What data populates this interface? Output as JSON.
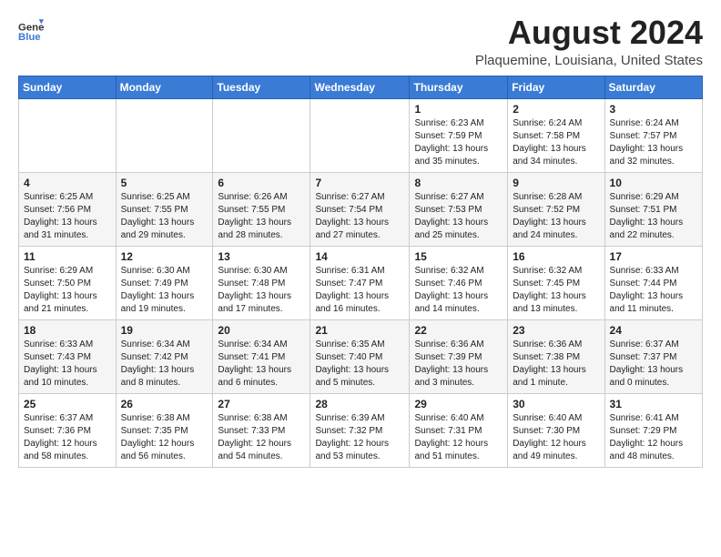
{
  "header": {
    "logo_general": "General",
    "logo_blue": "Blue",
    "month_year": "August 2024",
    "location": "Plaquemine, Louisiana, United States"
  },
  "weekdays": [
    "Sunday",
    "Monday",
    "Tuesday",
    "Wednesday",
    "Thursday",
    "Friday",
    "Saturday"
  ],
  "weeks": [
    [
      {
        "day": "",
        "info": ""
      },
      {
        "day": "",
        "info": ""
      },
      {
        "day": "",
        "info": ""
      },
      {
        "day": "",
        "info": ""
      },
      {
        "day": "1",
        "info": "Sunrise: 6:23 AM\nSunset: 7:59 PM\nDaylight: 13 hours\nand 35 minutes."
      },
      {
        "day": "2",
        "info": "Sunrise: 6:24 AM\nSunset: 7:58 PM\nDaylight: 13 hours\nand 34 minutes."
      },
      {
        "day": "3",
        "info": "Sunrise: 6:24 AM\nSunset: 7:57 PM\nDaylight: 13 hours\nand 32 minutes."
      }
    ],
    [
      {
        "day": "4",
        "info": "Sunrise: 6:25 AM\nSunset: 7:56 PM\nDaylight: 13 hours\nand 31 minutes."
      },
      {
        "day": "5",
        "info": "Sunrise: 6:25 AM\nSunset: 7:55 PM\nDaylight: 13 hours\nand 29 minutes."
      },
      {
        "day": "6",
        "info": "Sunrise: 6:26 AM\nSunset: 7:55 PM\nDaylight: 13 hours\nand 28 minutes."
      },
      {
        "day": "7",
        "info": "Sunrise: 6:27 AM\nSunset: 7:54 PM\nDaylight: 13 hours\nand 27 minutes."
      },
      {
        "day": "8",
        "info": "Sunrise: 6:27 AM\nSunset: 7:53 PM\nDaylight: 13 hours\nand 25 minutes."
      },
      {
        "day": "9",
        "info": "Sunrise: 6:28 AM\nSunset: 7:52 PM\nDaylight: 13 hours\nand 24 minutes."
      },
      {
        "day": "10",
        "info": "Sunrise: 6:29 AM\nSunset: 7:51 PM\nDaylight: 13 hours\nand 22 minutes."
      }
    ],
    [
      {
        "day": "11",
        "info": "Sunrise: 6:29 AM\nSunset: 7:50 PM\nDaylight: 13 hours\nand 21 minutes."
      },
      {
        "day": "12",
        "info": "Sunrise: 6:30 AM\nSunset: 7:49 PM\nDaylight: 13 hours\nand 19 minutes."
      },
      {
        "day": "13",
        "info": "Sunrise: 6:30 AM\nSunset: 7:48 PM\nDaylight: 13 hours\nand 17 minutes."
      },
      {
        "day": "14",
        "info": "Sunrise: 6:31 AM\nSunset: 7:47 PM\nDaylight: 13 hours\nand 16 minutes."
      },
      {
        "day": "15",
        "info": "Sunrise: 6:32 AM\nSunset: 7:46 PM\nDaylight: 13 hours\nand 14 minutes."
      },
      {
        "day": "16",
        "info": "Sunrise: 6:32 AM\nSunset: 7:45 PM\nDaylight: 13 hours\nand 13 minutes."
      },
      {
        "day": "17",
        "info": "Sunrise: 6:33 AM\nSunset: 7:44 PM\nDaylight: 13 hours\nand 11 minutes."
      }
    ],
    [
      {
        "day": "18",
        "info": "Sunrise: 6:33 AM\nSunset: 7:43 PM\nDaylight: 13 hours\nand 10 minutes."
      },
      {
        "day": "19",
        "info": "Sunrise: 6:34 AM\nSunset: 7:42 PM\nDaylight: 13 hours\nand 8 minutes."
      },
      {
        "day": "20",
        "info": "Sunrise: 6:34 AM\nSunset: 7:41 PM\nDaylight: 13 hours\nand 6 minutes."
      },
      {
        "day": "21",
        "info": "Sunrise: 6:35 AM\nSunset: 7:40 PM\nDaylight: 13 hours\nand 5 minutes."
      },
      {
        "day": "22",
        "info": "Sunrise: 6:36 AM\nSunset: 7:39 PM\nDaylight: 13 hours\nand 3 minutes."
      },
      {
        "day": "23",
        "info": "Sunrise: 6:36 AM\nSunset: 7:38 PM\nDaylight: 13 hours\nand 1 minute."
      },
      {
        "day": "24",
        "info": "Sunrise: 6:37 AM\nSunset: 7:37 PM\nDaylight: 13 hours\nand 0 minutes."
      }
    ],
    [
      {
        "day": "25",
        "info": "Sunrise: 6:37 AM\nSunset: 7:36 PM\nDaylight: 12 hours\nand 58 minutes."
      },
      {
        "day": "26",
        "info": "Sunrise: 6:38 AM\nSunset: 7:35 PM\nDaylight: 12 hours\nand 56 minutes."
      },
      {
        "day": "27",
        "info": "Sunrise: 6:38 AM\nSunset: 7:33 PM\nDaylight: 12 hours\nand 54 minutes."
      },
      {
        "day": "28",
        "info": "Sunrise: 6:39 AM\nSunset: 7:32 PM\nDaylight: 12 hours\nand 53 minutes."
      },
      {
        "day": "29",
        "info": "Sunrise: 6:40 AM\nSunset: 7:31 PM\nDaylight: 12 hours\nand 51 minutes."
      },
      {
        "day": "30",
        "info": "Sunrise: 6:40 AM\nSunset: 7:30 PM\nDaylight: 12 hours\nand 49 minutes."
      },
      {
        "day": "31",
        "info": "Sunrise: 6:41 AM\nSunset: 7:29 PM\nDaylight: 12 hours\nand 48 minutes."
      }
    ]
  ]
}
